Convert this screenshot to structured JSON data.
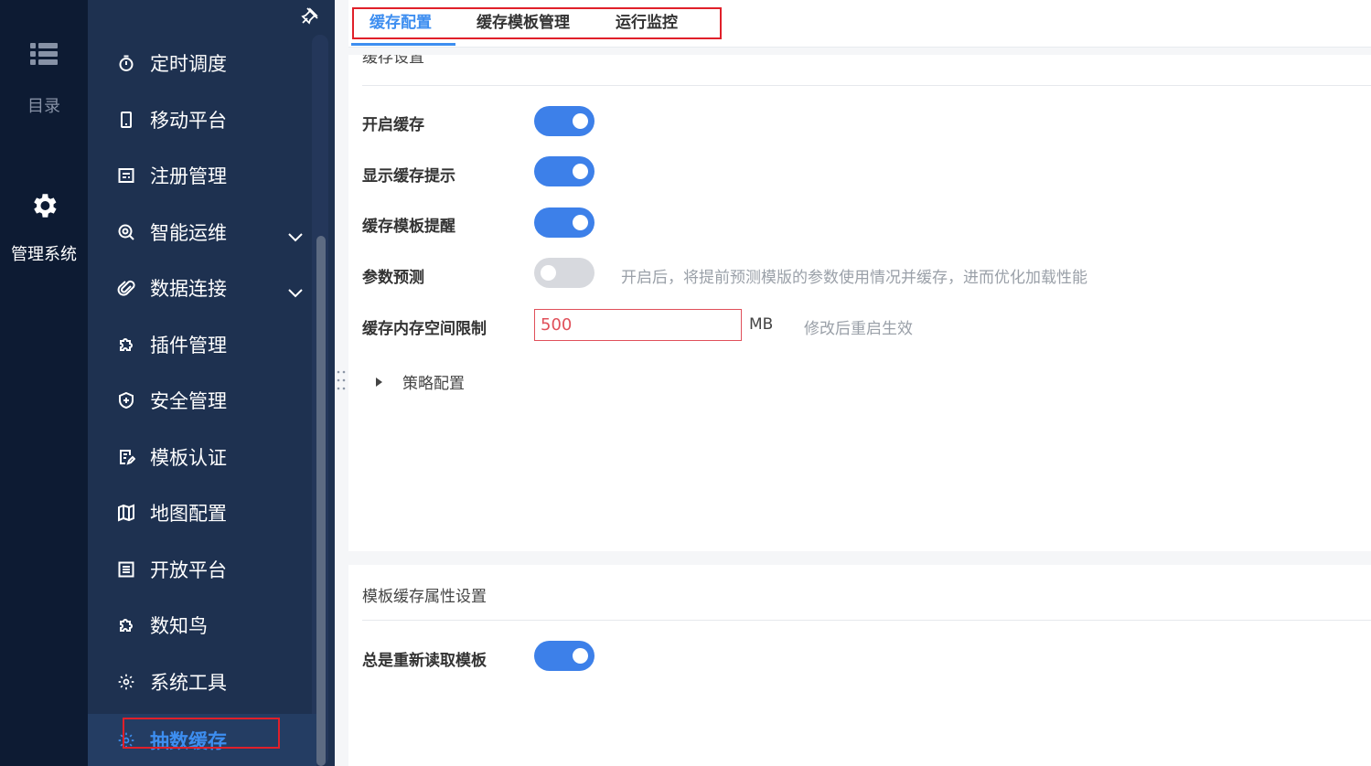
{
  "rail": {
    "catalog_label": "目录",
    "admin_label": "管理系统"
  },
  "menu": {
    "items": [
      {
        "label": "定时调度",
        "icon": "timer-icon"
      },
      {
        "label": "移动平台",
        "icon": "mobile-icon"
      },
      {
        "label": "注册管理",
        "icon": "register-icon"
      },
      {
        "label": "智能运维",
        "icon": "ops-icon",
        "expandable": true
      },
      {
        "label": "数据连接",
        "icon": "paperclip-icon",
        "expandable": true
      },
      {
        "label": "插件管理",
        "icon": "puzzle-icon"
      },
      {
        "label": "安全管理",
        "icon": "shield-plus-icon"
      },
      {
        "label": "模板认证",
        "icon": "document-edit-icon"
      },
      {
        "label": "地图配置",
        "icon": "map-icon"
      },
      {
        "label": "开放平台",
        "icon": "list-icon"
      },
      {
        "label": "数知鸟",
        "icon": "puzzle-icon"
      },
      {
        "label": "系统工具",
        "icon": "gear-tool-icon"
      },
      {
        "label": "抽数缓存",
        "icon": "gear-icon",
        "active": true
      }
    ]
  },
  "tabs": [
    {
      "label": "缓存配置",
      "active": true
    },
    {
      "label": "缓存模板管理"
    },
    {
      "label": "运行监控"
    }
  ],
  "cache_settings": {
    "title_partial": "缓存设置",
    "enable_cache": {
      "label": "开启缓存",
      "on": true
    },
    "show_hint": {
      "label": "显示缓存提示",
      "on": true
    },
    "template_reminder": {
      "label": "缓存模板提醒",
      "on": true
    },
    "param_predict": {
      "label": "参数预测",
      "on": false,
      "hint": "开启后，将提前预测模版的参数使用情况并缓存，进而优化加载性能"
    },
    "memory_limit": {
      "label": "缓存内存空间限制",
      "value": "500",
      "unit": "MB",
      "hint": "修改后重启生效"
    },
    "policy": {
      "label": "策略配置"
    }
  },
  "template_cache": {
    "title": "模板缓存属性设置",
    "always_reload": {
      "label": "总是重新读取模板",
      "on": true
    }
  },
  "colors": {
    "accent": "#3d8ef0",
    "toggle_on": "#3d80e9",
    "toggle_off": "#d7d9de",
    "sidebar": "#1e3150",
    "rail": "#0d1b33",
    "highlight_box": "#e0202a"
  }
}
